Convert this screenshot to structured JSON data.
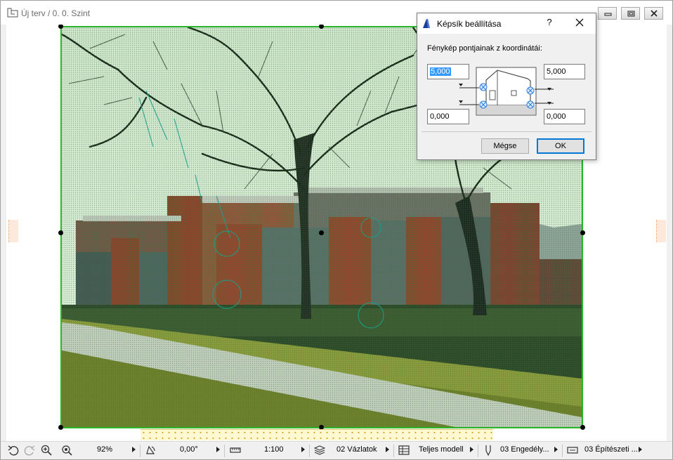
{
  "window": {
    "title": "Új terv / 0. 0. Szint"
  },
  "dialog": {
    "title": "Képsík beállítása",
    "help_label": "?",
    "prompt": "Fénykép pontjainak z koordinátái:",
    "fields": {
      "top_left": "5,000",
      "top_right": "5,000",
      "bottom_left": "0,000",
      "bottom_right": "0,000"
    },
    "cancel_label": "Mégse",
    "ok_label": "OK"
  },
  "toolbar": {
    "zoom": "92%",
    "angle": "0,00°",
    "scale": "1:100",
    "layer_set": "02 Vázlatok",
    "model_view": "Teljes modell",
    "pen_set": "03 Engedély...",
    "dimension": "03 Építészeti ..."
  },
  "icons": {
    "undo": "undo-icon",
    "redo": "redo-icon",
    "zoom_in": "zoom-in-icon",
    "zoom_fit": "zoom-fit-icon"
  },
  "colors": {
    "selection": "#2ab52a",
    "ok_focus": "#0078d7",
    "field_highlight": "#3399ff"
  }
}
